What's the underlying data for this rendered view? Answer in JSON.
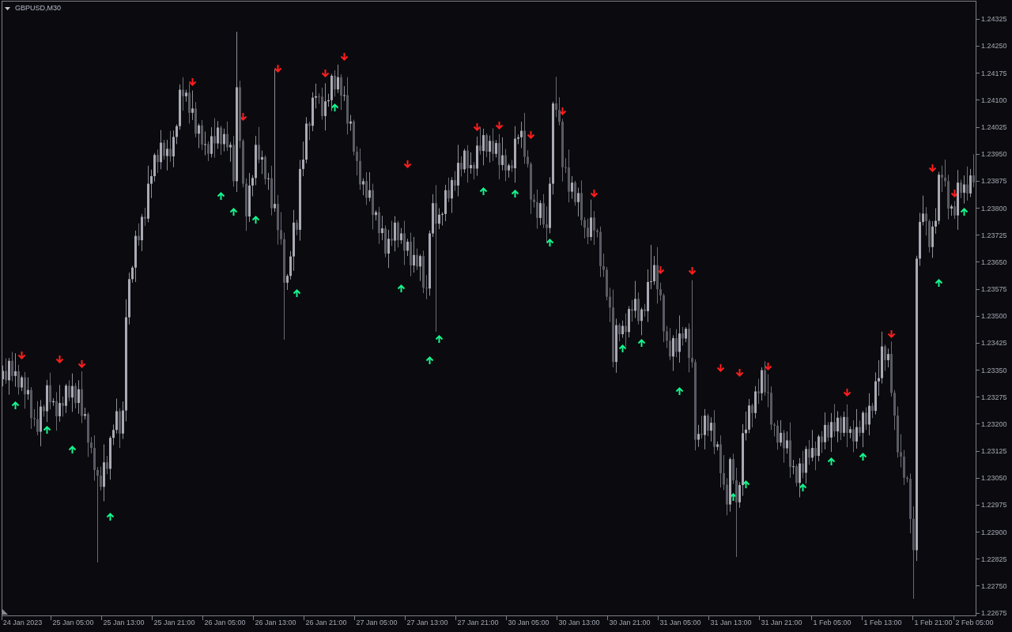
{
  "chart": {
    "chart_data": {
      "type": "candlestick",
      "title": "GBPUSD,M30",
      "ylim": [
        1.22671,
        1.24374
      ],
      "categories": [
        null,
        null,
        null,
        null,
        null,
        null,
        "24 Jan 2023",
        null,
        null,
        null,
        null,
        null,
        null,
        null,
        null,
        null,
        null,
        null,
        null,
        null,
        null,
        null,
        "25 Jan 05:00",
        null,
        null,
        null,
        null,
        null,
        null,
        null,
        null,
        null,
        null,
        null,
        null,
        null,
        null,
        null,
        "25 Jan 13:00",
        null,
        null,
        null,
        null,
        null,
        null,
        null,
        null,
        null,
        null,
        null,
        null,
        null,
        null,
        null,
        "25 Jan 21:00",
        null,
        null,
        null,
        null,
        null,
        null,
        null,
        null,
        null,
        null,
        null,
        null,
        null,
        null,
        null,
        "26 Jan 05:00",
        null,
        null,
        null,
        null,
        null,
        null,
        null,
        null,
        null,
        null,
        null,
        null,
        null,
        null,
        null,
        "26 Jan 13:00",
        null,
        null,
        null,
        null,
        null,
        null,
        null,
        null,
        null,
        null,
        null,
        null,
        null,
        null,
        null,
        "26 Jan 21:00",
        null,
        null,
        null,
        null,
        null,
        null,
        null,
        null,
        null,
        null,
        null,
        null,
        null,
        null,
        null,
        "27 Jan 05:00",
        null,
        null,
        null,
        null,
        null,
        null,
        null,
        null,
        null,
        null,
        null,
        null,
        null,
        null,
        null,
        "27 Jan 13:00",
        null,
        null,
        null,
        null,
        null,
        null,
        null,
        null,
        null,
        null,
        null,
        null,
        null,
        null,
        null,
        "27 Jan 21:00",
        null,
        null,
        null,
        null,
        null,
        null,
        null,
        null,
        null,
        null,
        null,
        null,
        null,
        null,
        null,
        "30 Jan 05:00",
        null,
        null,
        null,
        null,
        null,
        null,
        null,
        null,
        null,
        null,
        null,
        null,
        null,
        null,
        null,
        "30 Jan 13:00",
        null,
        null,
        null,
        null,
        null,
        null,
        null,
        null,
        null,
        null,
        null,
        null,
        null,
        null,
        null,
        "30 Jan 21:00",
        null,
        null,
        null,
        null,
        null,
        null,
        null,
        null,
        null,
        null,
        null,
        null,
        null,
        null,
        null,
        "31 Jan 05:00",
        null,
        null,
        null,
        null,
        null,
        null,
        null,
        null,
        null,
        null,
        null,
        null,
        null,
        null,
        null,
        "31 Jan 13:00",
        null,
        null,
        null,
        null,
        null,
        null,
        null,
        null,
        null,
        null,
        null,
        null,
        null,
        null,
        null,
        "31 Jan 21:00",
        null,
        null,
        null,
        null,
        null,
        null,
        null,
        null,
        null,
        null,
        null,
        null,
        null,
        null,
        null,
        "1 Feb 05:00",
        null,
        null,
        null,
        null,
        null,
        null,
        null,
        null,
        null,
        null,
        null,
        null,
        null,
        null,
        null,
        "1 Feb 13:00",
        null,
        null,
        null,
        null,
        null,
        null,
        null,
        null,
        null,
        null,
        null,
        null,
        null,
        null,
        null,
        "1 Feb 21:00",
        null,
        null,
        null,
        null,
        null,
        null,
        null,
        null,
        null,
        null,
        null,
        null,
        "2 Feb 05:00"
      ],
      "ohlc": [
        [
          1.23325,
          1.23363,
          1.23305,
          1.23348
        ],
        [
          1.23348,
          1.23383,
          1.23312,
          1.23322
        ],
        [
          1.23322,
          1.23384,
          1.23282,
          1.23376
        ],
        [
          1.23376,
          1.23401,
          1.23319,
          1.23334
        ],
        [
          1.23334,
          1.23397,
          1.23304,
          1.23347
        ],
        [
          1.23347,
          1.23365,
          1.23282,
          1.23302
        ],
        [
          1.23302,
          1.23335,
          1.23292,
          1.2333
        ],
        [
          1.2333,
          1.23345,
          1.23243,
          1.23283
        ],
        [
          1.23283,
          1.2333,
          1.23268,
          1.23295
        ],
        [
          1.23295,
          1.23303,
          1.23187,
          1.23217
        ],
        [
          1.23217,
          1.23242,
          1.23194,
          1.23214
        ],
        [
          1.23214,
          1.23264,
          1.23169,
          1.23179
        ],
        [
          1.23179,
          1.23267,
          1.23139,
          1.23249
        ],
        [
          1.23249,
          1.23254,
          1.23221,
          1.23236
        ],
        [
          1.23236,
          1.23323,
          1.23206,
          1.23308
        ],
        [
          1.23308,
          1.23343,
          1.23241,
          1.23261
        ],
        [
          1.23261,
          1.23272,
          1.23251,
          1.23264
        ],
        [
          1.23264,
          1.23289,
          1.23182,
          1.23222
        ],
        [
          1.23222,
          1.23309,
          1.23207,
          1.23259
        ],
        [
          1.23259,
          1.23277,
          1.23221,
          1.23251
        ],
        [
          1.23251,
          1.23312,
          1.23231,
          1.23307
        ],
        [
          1.23307,
          1.23322,
          1.23264,
          1.23274
        ],
        [
          1.23274,
          1.23341,
          1.23234,
          1.23306
        ],
        [
          1.23306,
          1.23314,
          1.23244,
          1.23259
        ],
        [
          1.23259,
          1.23322,
          1.23229,
          1.23297
        ],
        [
          1.23297,
          1.23347,
          1.23203,
          1.23223
        ],
        [
          1.23223,
          1.23246,
          1.23213,
          1.23228
        ],
        [
          1.23228,
          1.23233,
          1.23109,
          1.23149
        ],
        [
          1.23149,
          1.23164,
          1.23119,
          1.23134
        ],
        [
          1.23134,
          1.23169,
          1.23043,
          1.23073
        ],
        [
          1.23073,
          1.23081,
          1.22816,
          1.23057
        ],
        [
          1.23057,
          1.23082,
          1.23016,
          1.23026
        ],
        [
          1.23026,
          1.23144,
          1.22986,
          1.23094
        ],
        [
          1.23094,
          1.23112,
          1.23061,
          1.23076
        ],
        [
          1.23076,
          1.23167,
          1.23046,
          1.23162
        ],
        [
          1.23162,
          1.23199,
          1.23142,
          1.23184
        ],
        [
          1.23184,
          1.23271,
          1.23174,
          1.23236
        ],
        [
          1.23236,
          1.23244,
          1.23134,
          1.23174
        ],
        [
          1.23174,
          1.23263,
          1.23159,
          1.23238
        ],
        [
          1.23238,
          1.23547,
          1.23208,
          1.23497
        ],
        [
          1.23497,
          1.23621,
          1.23477,
          1.23603
        ],
        [
          1.23603,
          1.2364,
          1.23593,
          1.23635
        ],
        [
          1.23635,
          1.23738,
          1.23595,
          1.23723
        ],
        [
          1.23723,
          1.23758,
          1.23696,
          1.23711
        ],
        [
          1.23711,
          1.23784,
          1.23681,
          1.23776
        ],
        [
          1.23776,
          1.23801,
          1.23751,
          1.23771
        ],
        [
          1.23771,
          1.23918,
          1.23761,
          1.23868
        ],
        [
          1.23868,
          1.23907,
          1.23828,
          1.23889
        ],
        [
          1.23889,
          1.23953,
          1.23874,
          1.23948
        ],
        [
          1.23948,
          1.23963,
          1.23898,
          1.23928
        ],
        [
          1.23928,
          1.24017,
          1.23908,
          1.23982
        ],
        [
          1.23982,
          1.2399,
          1.23935,
          1.23945
        ],
        [
          1.23945,
          1.2399,
          1.23905,
          1.23965
        ],
        [
          1.23965,
          1.24015,
          1.23929,
          1.23944
        ],
        [
          1.23944,
          1.24016,
          1.23914,
          1.23998
        ],
        [
          1.23998,
          1.24033,
          1.23978,
          1.24028
        ],
        [
          1.24028,
          1.24144,
          1.24018,
          1.24129
        ],
        [
          1.24129,
          1.24164,
          1.24071,
          1.24111
        ],
        [
          1.24111,
          1.24129,
          1.24096,
          1.24121
        ],
        [
          1.24121,
          1.24146,
          1.24035,
          1.24065
        ],
        [
          1.24065,
          1.24127,
          1.24045,
          1.24077
        ],
        [
          1.24077,
          1.24095,
          1.23997,
          1.24007
        ],
        [
          1.24007,
          1.24035,
          1.23967,
          1.2403
        ],
        [
          1.2403,
          1.24045,
          1.23962,
          1.23977
        ],
        [
          1.23977,
          1.24013,
          1.23947,
          1.23978
        ],
        [
          1.23978,
          1.23986,
          1.23931,
          1.23951
        ],
        [
          1.23951,
          1.24025,
          1.23941,
          1.24
        ],
        [
          1.24,
          1.2405,
          1.2394,
          1.2398
        ],
        [
          1.2398,
          1.24042,
          1.23965,
          1.24024
        ],
        [
          1.24024,
          1.24029,
          1.23948,
          1.23978
        ],
        [
          1.23978,
          1.24021,
          1.23958,
          1.24006
        ],
        [
          1.24006,
          1.24041,
          1.23959,
          1.23969
        ],
        [
          1.23969,
          1.23984,
          1.23929,
          1.23976
        ],
        [
          1.23976,
          1.24001,
          1.2386,
          1.23875
        ],
        [
          1.23875,
          1.2429,
          1.23845,
          1.24136
        ],
        [
          1.24136,
          1.24154,
          1.23967,
          1.23987
        ],
        [
          1.23987,
          1.23992,
          1.23858,
          1.23868
        ],
        [
          1.23868,
          1.23883,
          1.23737,
          1.23777
        ],
        [
          1.23777,
          1.23898,
          1.23762,
          1.23863
        ],
        [
          1.23863,
          1.23892,
          1.23833,
          1.23884
        ],
        [
          1.23884,
          1.24001,
          1.23864,
          1.23976
        ],
        [
          1.23976,
          1.24026,
          1.23925,
          1.23935
        ],
        [
          1.23935,
          1.2396,
          1.23895,
          1.23942
        ],
        [
          1.23942,
          1.23947,
          1.23866,
          1.23881
        ],
        [
          1.23881,
          1.23898,
          1.23851,
          1.23883
        ],
        [
          1.23883,
          1.23918,
          1.2378,
          1.238
        ],
        [
          1.238,
          1.24185,
          1.2379,
          1.23812
        ],
        [
          1.23812,
          1.23837,
          1.23699,
          1.23739
        ],
        [
          1.23739,
          1.23789,
          1.23699,
          1.23714
        ],
        [
          1.23714,
          1.23732,
          1.23435,
          1.23593
        ],
        [
          1.23593,
          1.23617,
          1.23573,
          1.23612
        ],
        [
          1.23612,
          1.23681,
          1.23602,
          1.23666
        ],
        [
          1.23666,
          1.23795,
          1.23626,
          1.2376
        ],
        [
          1.2376,
          1.23768,
          1.23725,
          1.2374
        ],
        [
          1.2374,
          1.23934,
          1.2371,
          1.23909
        ],
        [
          1.23909,
          1.23985,
          1.23889,
          1.23935
        ],
        [
          1.23935,
          1.24053,
          1.23925,
          1.24035
        ],
        [
          1.24035,
          1.2404,
          1.23989,
          1.24029
        ],
        [
          1.24029,
          1.24122,
          1.24014,
          1.24107
        ],
        [
          1.24107,
          1.24146,
          1.24077,
          1.24111
        ],
        [
          1.24111,
          1.24119,
          1.2409,
          1.2411
        ],
        [
          1.2411,
          1.24135,
          1.24046,
          1.24056
        ],
        [
          1.24056,
          1.24147,
          1.24016,
          1.24097
        ],
        [
          1.24097,
          1.24118,
          1.24082,
          1.241
        ],
        [
          1.241,
          1.24173,
          1.2407,
          1.24168
        ],
        [
          1.24168,
          1.24183,
          1.2411,
          1.2413
        ],
        [
          1.2413,
          1.24199,
          1.2412,
          1.24164
        ],
        [
          1.24164,
          1.24172,
          1.24073,
          1.24113
        ],
        [
          1.24113,
          1.24139,
          1.24098,
          1.24114
        ],
        [
          1.24114,
          1.24164,
          1.24005,
          1.24035
        ],
        [
          1.24035,
          1.24059,
          1.24015,
          1.24041
        ],
        [
          1.24041,
          1.24046,
          1.23947,
          1.23957
        ],
        [
          1.23957,
          1.23972,
          1.23891,
          1.23931
        ],
        [
          1.23931,
          1.23966,
          1.23851,
          1.23866
        ],
        [
          1.23866,
          1.23883,
          1.23836,
          1.23875
        ],
        [
          1.23875,
          1.239,
          1.23809,
          1.23829
        ],
        [
          1.23829,
          1.239,
          1.23819,
          1.2385
        ],
        [
          1.2385,
          1.23868,
          1.23741,
          1.23781
        ],
        [
          1.23781,
          1.23794,
          1.23766,
          1.23789
        ],
        [
          1.23789,
          1.23804,
          1.23701,
          1.23731
        ],
        [
          1.23731,
          1.23779,
          1.23711,
          1.23744
        ],
        [
          1.23744,
          1.23752,
          1.23664,
          1.23674
        ],
        [
          1.23674,
          1.2374,
          1.23634,
          1.23715
        ],
        [
          1.23715,
          1.23765,
          1.23695,
          1.2371
        ],
        [
          1.2371,
          1.23778,
          1.2368,
          1.2376
        ],
        [
          1.2376,
          1.23765,
          1.23691,
          1.23711
        ],
        [
          1.23711,
          1.23745,
          1.23701,
          1.2373
        ],
        [
          1.2373,
          1.23765,
          1.23642,
          1.23682
        ],
        [
          1.23682,
          1.23715,
          1.23667,
          1.23707
        ],
        [
          1.23707,
          1.23732,
          1.23611,
          1.23641
        ],
        [
          1.23641,
          1.2372,
          1.23621,
          1.2367
        ],
        [
          1.2367,
          1.23688,
          1.23628,
          1.23638
        ],
        [
          1.23638,
          1.23672,
          1.23598,
          1.23667
        ],
        [
          1.23667,
          1.23682,
          1.23564,
          1.23579
        ],
        [
          1.23579,
          1.23614,
          1.23547,
          1.23577
        ],
        [
          1.23577,
          1.23738,
          1.23557,
          1.2373
        ],
        [
          1.2373,
          1.23839,
          1.2372,
          1.23814
        ],
        [
          1.23814,
          1.23864,
          1.23457,
          1.23757
        ],
        [
          1.23757,
          1.238,
          1.23742,
          1.23782
        ],
        [
          1.23782,
          1.23789,
          1.23752,
          1.23784
        ],
        [
          1.23784,
          1.23865,
          1.23764,
          1.2385
        ],
        [
          1.2385,
          1.23885,
          1.23817,
          1.23827
        ],
        [
          1.23827,
          1.23886,
          1.23787,
          1.23878
        ],
        [
          1.23878,
          1.23903,
          1.23848,
          1.23863
        ],
        [
          1.23863,
          1.23976,
          1.23833,
          1.23926
        ],
        [
          1.23926,
          1.23944,
          1.23888,
          1.23908
        ],
        [
          1.23908,
          1.23965,
          1.23898,
          1.2396
        ],
        [
          1.2396,
          1.23975,
          1.23871,
          1.23911
        ],
        [
          1.23911,
          1.23955,
          1.23896,
          1.2392
        ],
        [
          1.2392,
          1.23928,
          1.2388,
          1.2391
        ],
        [
          1.2391,
          1.23999,
          1.2389,
          1.23974
        ],
        [
          1.23974,
          1.24024,
          1.23949,
          1.23959
        ],
        [
          1.23959,
          1.24021,
          1.23919,
          1.24003
        ],
        [
          1.24003,
          1.24008,
          1.23942,
          1.23957
        ],
        [
          1.23957,
          1.24002,
          1.23927,
          1.23987
        ],
        [
          1.23987,
          1.24022,
          1.23931,
          1.23951
        ],
        [
          1.23951,
          1.23989,
          1.23941,
          1.23981
        ],
        [
          1.23981,
          1.24006,
          1.2388,
          1.2392
        ],
        [
          1.2392,
          1.23997,
          1.23905,
          1.23947
        ],
        [
          1.23947,
          1.23965,
          1.23875,
          1.23905
        ],
        [
          1.23905,
          1.23924,
          1.23885,
          1.23919
        ],
        [
          1.23919,
          1.23934,
          1.23901,
          1.23911
        ],
        [
          1.23911,
          1.24028,
          1.23871,
          1.23993
        ],
        [
          1.23993,
          1.24005,
          1.23978,
          1.23997
        ],
        [
          1.23997,
          1.2404,
          1.23967,
          1.24015
        ],
        [
          1.24015,
          1.24065,
          1.23923,
          1.23943
        ],
        [
          1.23943,
          1.23961,
          1.23913,
          1.23923
        ],
        [
          1.23923,
          1.23928,
          1.23784,
          1.23824
        ],
        [
          1.23824,
          1.23839,
          1.23802,
          1.23817
        ],
        [
          1.23817,
          1.23852,
          1.23743,
          1.23773
        ],
        [
          1.23773,
          1.23822,
          1.23753,
          1.23814
        ],
        [
          1.23814,
          1.23839,
          1.23745,
          1.23755
        ],
        [
          1.23755,
          1.23805,
          1.23705,
          1.23745
        ],
        [
          1.23745,
          1.23886,
          1.2373,
          1.23868
        ],
        [
          1.23868,
          1.24096,
          1.23838,
          1.24091
        ],
        [
          1.24091,
          1.24165,
          1.24053,
          1.24073
        ],
        [
          1.24073,
          1.24108,
          1.2403,
          1.2404
        ],
        [
          1.2404,
          1.24048,
          1.23874,
          1.23914
        ],
        [
          1.23914,
          1.23939,
          1.23898,
          1.23913
        ],
        [
          1.23913,
          1.23963,
          1.23816,
          1.23846
        ],
        [
          1.23846,
          1.23889,
          1.23826,
          1.23871
        ],
        [
          1.23871,
          1.23876,
          1.23807,
          1.23817
        ],
        [
          1.23817,
          1.23857,
          1.23777,
          1.23842
        ],
        [
          1.23842,
          1.23877,
          1.23752,
          1.23767
        ],
        [
          1.23767,
          1.23775,
          1.23716,
          1.23746
        ],
        [
          1.23746,
          1.23771,
          1.237,
          1.2372
        ],
        [
          1.2372,
          1.23824,
          1.2371,
          1.23774
        ],
        [
          1.23774,
          1.23792,
          1.23698,
          1.23738
        ],
        [
          1.23738,
          1.23743,
          1.23719,
          1.23734
        ],
        [
          1.23734,
          1.23749,
          1.23609,
          1.23639
        ],
        [
          1.23639,
          1.23674,
          1.23609,
          1.23629
        ],
        [
          1.23629,
          1.23637,
          1.23544,
          1.23554
        ],
        [
          1.23554,
          1.23579,
          1.23484,
          1.23524
        ],
        [
          1.23524,
          1.23574,
          1.23358,
          1.23373
        ],
        [
          1.23373,
          1.23493,
          1.23343,
          1.23475
        ],
        [
          1.23475,
          1.2348,
          1.2343,
          1.2345
        ],
        [
          1.2345,
          1.23488,
          1.2344,
          1.23473
        ],
        [
          1.23473,
          1.23508,
          1.23416,
          1.23456
        ],
        [
          1.23456,
          1.23528,
          1.23441,
          1.2352
        ],
        [
          1.2352,
          1.23545,
          1.23485,
          1.23515
        ],
        [
          1.23515,
          1.23598,
          1.23495,
          1.23548
        ],
        [
          1.23548,
          1.23566,
          1.23477,
          1.23487
        ],
        [
          1.23487,
          1.23524,
          1.23447,
          1.23519
        ],
        [
          1.23519,
          1.23534,
          1.23499,
          1.23514
        ],
        [
          1.23514,
          1.2363,
          1.23484,
          1.23595
        ],
        [
          1.23595,
          1.23698,
          1.23575,
          1.23597
        ],
        [
          1.23597,
          1.23667,
          1.23587,
          1.23642
        ],
        [
          1.23642,
          1.23692,
          1.23535,
          1.23575
        ],
        [
          1.23575,
          1.23593,
          1.23543,
          1.23558
        ],
        [
          1.23558,
          1.23563,
          1.23428,
          1.23458
        ],
        [
          1.23458,
          1.23473,
          1.23412,
          1.23432
        ],
        [
          1.23432,
          1.23467,
          1.23378,
          1.23388
        ],
        [
          1.23388,
          1.23447,
          1.23348,
          1.23439
        ],
        [
          1.23439,
          1.23464,
          1.23386,
          1.23401
        ],
        [
          1.23401,
          1.23502,
          1.23371,
          1.23452
        ],
        [
          1.23452,
          1.2347,
          1.23418,
          1.23438
        ],
        [
          1.23438,
          1.2347,
          1.23428,
          1.23465
        ],
        [
          1.23465,
          1.2348,
          1.23344,
          1.23384
        ],
        [
          1.23384,
          1.236,
          1.23357,
          1.23372
        ],
        [
          1.23372,
          1.2338,
          1.23127,
          1.23157
        ],
        [
          1.23157,
          1.23198,
          1.23137,
          1.23173
        ],
        [
          1.23173,
          1.23223,
          1.2316,
          1.2317
        ],
        [
          1.2317,
          1.23242,
          1.2313,
          1.23224
        ],
        [
          1.23224,
          1.23229,
          1.23167,
          1.23182
        ],
        [
          1.23182,
          1.23219,
          1.23152,
          1.23204
        ],
        [
          1.23204,
          1.23239,
          1.23117,
          1.23137
        ],
        [
          1.23137,
          1.23152,
          1.23127,
          1.23144
        ],
        [
          1.23144,
          1.23169,
          1.23024,
          1.23064
        ],
        [
          1.23064,
          1.23114,
          1.23017,
          1.23032
        ],
        [
          1.23032,
          1.2305,
          1.22947,
          1.22977
        ],
        [
          1.22977,
          1.23108,
          1.22957,
          1.23103
        ],
        [
          1.23103,
          1.23118,
          1.23034,
          1.23044
        ],
        [
          1.23044,
          1.23079,
          1.22831,
          1.22983
        ],
        [
          1.22983,
          1.23039,
          1.22968,
          1.23031
        ],
        [
          1.23031,
          1.232,
          1.23001,
          1.23175
        ],
        [
          1.23175,
          1.23235,
          1.23155,
          1.23185
        ],
        [
          1.23185,
          1.2327,
          1.23175,
          1.23252
        ],
        [
          1.23252,
          1.23257,
          1.23191,
          1.23231
        ],
        [
          1.23231,
          1.23306,
          1.23216,
          1.23291
        ],
        [
          1.23291,
          1.23326,
          1.23256,
          1.23286
        ],
        [
          1.23286,
          1.23358,
          1.23266,
          1.2335
        ],
        [
          1.2335,
          1.23375,
          1.23279,
          1.23289
        ],
        [
          1.23289,
          1.23339,
          1.23247,
          1.23287
        ],
        [
          1.23287,
          1.23305,
          1.23184,
          1.23199
        ],
        [
          1.23199,
          1.23204,
          1.23166,
          1.23196
        ],
        [
          1.23196,
          1.23211,
          1.23129,
          1.23149
        ],
        [
          1.23149,
          1.23211,
          1.23139,
          1.23176
        ],
        [
          1.23176,
          1.23184,
          1.23093,
          1.23133
        ],
        [
          1.23133,
          1.2318,
          1.23118,
          1.23155
        ],
        [
          1.23155,
          1.23205,
          1.23051,
          1.23081
        ],
        [
          1.23081,
          1.23101,
          1.23061,
          1.23083
        ],
        [
          1.23083,
          1.23088,
          1.23027,
          1.23037
        ],
        [
          1.23037,
          1.23106,
          1.22997,
          1.23091
        ],
        [
          1.23091,
          1.23126,
          1.2305,
          1.23065
        ],
        [
          1.23065,
          1.23139,
          1.23035,
          1.23131
        ],
        [
          1.23131,
          1.23156,
          1.23087,
          1.23107
        ],
        [
          1.23107,
          1.23184,
          1.23097,
          1.23134
        ],
        [
          1.23134,
          1.23152,
          1.23072,
          1.23112
        ],
        [
          1.23112,
          1.23171,
          1.23097,
          1.23166
        ],
        [
          1.23166,
          1.23181,
          1.2312,
          1.2315
        ],
        [
          1.2315,
          1.23233,
          1.2313,
          1.23198
        ],
        [
          1.23198,
          1.23206,
          1.23153,
          1.23163
        ],
        [
          1.23163,
          1.23231,
          1.23123,
          1.23206
        ],
        [
          1.23206,
          1.23256,
          1.23165,
          1.2318
        ],
        [
          1.2318,
          1.23236,
          1.2315,
          1.23218
        ],
        [
          1.23218,
          1.23223,
          1.23156,
          1.23176
        ],
        [
          1.23176,
          1.23235,
          1.23166,
          1.2322
        ],
        [
          1.2322,
          1.23255,
          1.23136,
          1.23176
        ],
        [
          1.23176,
          1.23194,
          1.23161,
          1.23186
        ],
        [
          1.23186,
          1.23211,
          1.23122,
          1.23152
        ],
        [
          1.23152,
          1.23242,
          1.23132,
          1.23192
        ],
        [
          1.23192,
          1.2321,
          1.23166,
          1.23176
        ],
        [
          1.23176,
          1.23237,
          1.23136,
          1.23232
        ],
        [
          1.23232,
          1.23247,
          1.23184,
          1.23199
        ],
        [
          1.23199,
          1.23286,
          1.23169,
          1.23251
        ],
        [
          1.23251,
          1.23259,
          1.23217,
          1.23237
        ],
        [
          1.23237,
          1.23344,
          1.23227,
          1.23319
        ],
        [
          1.23319,
          1.23378,
          1.23279,
          1.23328
        ],
        [
          1.23328,
          1.23457,
          1.23313,
          1.23416
        ],
        [
          1.23416,
          1.23421,
          1.23348,
          1.23378
        ],
        [
          1.23378,
          1.2341,
          1.23358,
          1.23395
        ],
        [
          1.23395,
          1.2343,
          1.23277,
          1.23287
        ],
        [
          1.23287,
          1.23295,
          1.23184,
          1.23224
        ],
        [
          1.23224,
          1.23249,
          1.23107,
          1.23122
        ],
        [
          1.23122,
          1.23172,
          1.2308,
          1.2311
        ],
        [
          1.2311,
          1.23128,
          1.23031,
          1.23051
        ],
        [
          1.23051,
          1.23056,
          1.23038,
          1.23048
        ],
        [
          1.23048,
          1.23063,
          1.22897,
          1.22937
        ],
        [
          1.22937,
          1.22972,
          1.22715,
          1.2285
        ],
        [
          1.2285,
          1.23668,
          1.2282,
          1.2366
        ],
        [
          1.2366,
          1.23787,
          1.2364,
          1.23762
        ],
        [
          1.23762,
          1.23835,
          1.23752,
          1.23785
        ],
        [
          1.23785,
          1.23803,
          1.23724,
          1.23764
        ],
        [
          1.23764,
          1.23769,
          1.23677,
          1.23692
        ],
        [
          1.23692,
          1.23764,
          1.23662,
          1.23749
        ],
        [
          1.23749,
          1.238,
          1.23729,
          1.23765
        ],
        [
          1.23765,
          1.23901,
          1.23755,
          1.23893
        ],
        [
          1.23893,
          1.23918,
          1.23845,
          1.23885
        ],
        [
          1.23885,
          1.23935,
          1.2386,
          1.23875
        ],
        [
          1.23875,
          1.23893,
          1.23769,
          1.23799
        ],
        [
          1.23799,
          1.2381,
          1.23779,
          1.23805
        ],
        [
          1.23805,
          1.2382,
          1.2377,
          1.2378
        ],
        [
          1.2378,
          1.23906,
          1.2374,
          1.23871
        ],
        [
          1.23871,
          1.23879,
          1.23828,
          1.23843
        ],
        [
          1.23843,
          1.23891,
          1.23813,
          1.23866
        ],
        [
          1.23866,
          1.23916,
          1.23821,
          1.23841
        ],
        [
          1.23841,
          1.23909,
          1.23831,
          1.23891
        ],
        [
          1.23891,
          1.2395,
          1.23858,
          1.23872
        ]
      ],
      "yticks": [
        {
          "value": 1.24325,
          "label": "1.24325"
        },
        {
          "value": 1.2425,
          "label": "1.24250"
        },
        {
          "value": 1.24175,
          "label": "1.24175"
        },
        {
          "value": 1.241,
          "label": "1.24100"
        },
        {
          "value": 1.24025,
          "label": "1.24025"
        },
        {
          "value": 1.2395,
          "label": "1.23950"
        },
        {
          "value": 1.23875,
          "label": "1.23875"
        },
        {
          "value": 1.238,
          "label": "1.23800"
        },
        {
          "value": 1.23725,
          "label": "1.23725"
        },
        {
          "value": 1.2365,
          "label": "1.23650"
        },
        {
          "value": 1.23575,
          "label": "1.23575"
        },
        {
          "value": 1.235,
          "label": "1.23500"
        },
        {
          "value": 1.23425,
          "label": "1.23425"
        },
        {
          "value": 1.2335,
          "label": "1.23350"
        },
        {
          "value": 1.23275,
          "label": "1.23275"
        },
        {
          "value": 1.232,
          "label": "1.23200"
        },
        {
          "value": 1.23125,
          "label": "1.23125"
        },
        {
          "value": 1.2305,
          "label": "1.23050"
        },
        {
          "value": 1.22975,
          "label": "1.22975"
        },
        {
          "value": 1.229,
          "label": "1.22900"
        },
        {
          "value": 1.22825,
          "label": "1.22825"
        },
        {
          "value": 1.2275,
          "label": "1.22750"
        },
        {
          "value": 1.22675,
          "label": "1.22675"
        }
      ]
    }
  }
}
